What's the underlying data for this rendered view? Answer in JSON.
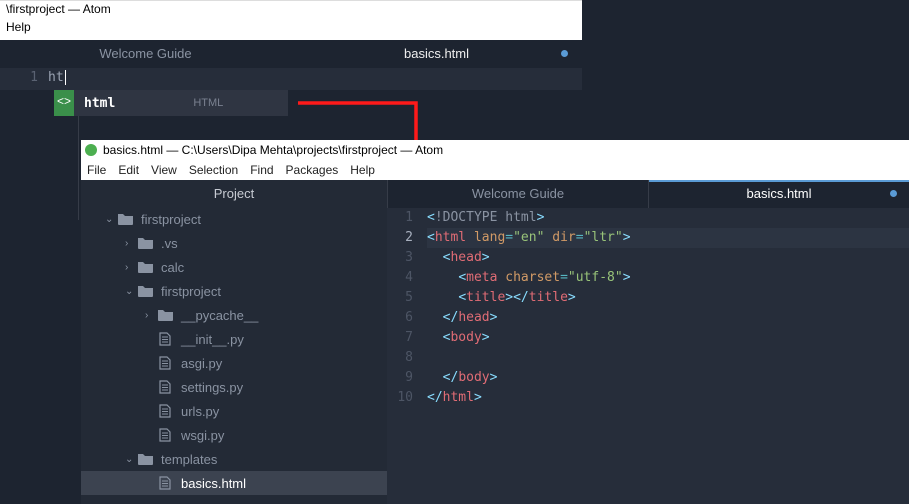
{
  "top": {
    "title": "\\firstproject — Atom",
    "menu_help": "Help",
    "tabs": [
      {
        "label": "Welcome Guide",
        "active": false,
        "modified": false
      },
      {
        "label": "basics.html",
        "active": true,
        "modified": true
      }
    ],
    "line_number": "1",
    "typed": "ht",
    "autocomplete": {
      "arrow": "<>",
      "label": "html",
      "hint": "HTML"
    }
  },
  "bottom": {
    "title": "basics.html — C:\\Users\\Dipa Mehta\\projects\\firstproject — Atom",
    "menu": [
      "File",
      "Edit",
      "View",
      "Selection",
      "Find",
      "Packages",
      "Help"
    ],
    "project_header": "Project",
    "tree": [
      {
        "depth": 0,
        "type": "folder",
        "open": true,
        "label": "firstproject"
      },
      {
        "depth": 1,
        "type": "folder",
        "open": false,
        "label": ".vs"
      },
      {
        "depth": 1,
        "type": "folder",
        "open": false,
        "label": "calc"
      },
      {
        "depth": 1,
        "type": "folder",
        "open": true,
        "label": "firstproject"
      },
      {
        "depth": 2,
        "type": "folder",
        "open": false,
        "label": "__pycache__"
      },
      {
        "depth": 2,
        "type": "file",
        "label": "__init__.py"
      },
      {
        "depth": 2,
        "type": "file",
        "label": "asgi.py"
      },
      {
        "depth": 2,
        "type": "file",
        "label": "settings.py"
      },
      {
        "depth": 2,
        "type": "file",
        "label": "urls.py"
      },
      {
        "depth": 2,
        "type": "file",
        "label": "wsgi.py"
      },
      {
        "depth": 1,
        "type": "folder",
        "open": true,
        "label": "templates"
      },
      {
        "depth": 2,
        "type": "file",
        "selected": true,
        "label": "basics.html"
      }
    ],
    "editor_tabs": [
      {
        "label": "Welcome Guide",
        "active": false
      },
      {
        "label": "basics.html",
        "active": true,
        "modified": true
      }
    ],
    "code_active_line": 2,
    "code": [
      [
        [
          "br",
          "<"
        ],
        [
          "doc",
          "!DOCTYPE html"
        ],
        [
          "br",
          ">"
        ]
      ],
      [
        [
          "br",
          "<"
        ],
        [
          "tag",
          "html "
        ],
        [
          "attr",
          "lang"
        ],
        [
          "op",
          "="
        ],
        [
          "str",
          "\"en\""
        ],
        [
          "attr",
          " dir"
        ],
        [
          "op",
          "="
        ],
        [
          "str",
          "\"ltr\""
        ],
        [
          "br",
          ">"
        ]
      ],
      [
        [
          "pad",
          "  "
        ],
        [
          "br",
          "<"
        ],
        [
          "tag",
          "head"
        ],
        [
          "br",
          ">"
        ]
      ],
      [
        [
          "pad",
          "    "
        ],
        [
          "br",
          "<"
        ],
        [
          "tag",
          "meta "
        ],
        [
          "attr",
          "charset"
        ],
        [
          "op",
          "="
        ],
        [
          "str",
          "\"utf-8\""
        ],
        [
          "br",
          ">"
        ]
      ],
      [
        [
          "pad",
          "    "
        ],
        [
          "br",
          "<"
        ],
        [
          "tag",
          "title"
        ],
        [
          "br",
          "></"
        ],
        [
          "tag",
          "title"
        ],
        [
          "br",
          ">"
        ]
      ],
      [
        [
          "pad",
          "  "
        ],
        [
          "br",
          "</"
        ],
        [
          "tag",
          "head"
        ],
        [
          "br",
          ">"
        ]
      ],
      [
        [
          "pad",
          "  "
        ],
        [
          "br",
          "<"
        ],
        [
          "tag",
          "body"
        ],
        [
          "br",
          ">"
        ]
      ],
      [],
      [
        [
          "pad",
          "  "
        ],
        [
          "br",
          "</"
        ],
        [
          "tag",
          "body"
        ],
        [
          "br",
          ">"
        ]
      ],
      [
        [
          "br",
          "</"
        ],
        [
          "tag",
          "html"
        ],
        [
          "br",
          ">"
        ]
      ]
    ]
  }
}
